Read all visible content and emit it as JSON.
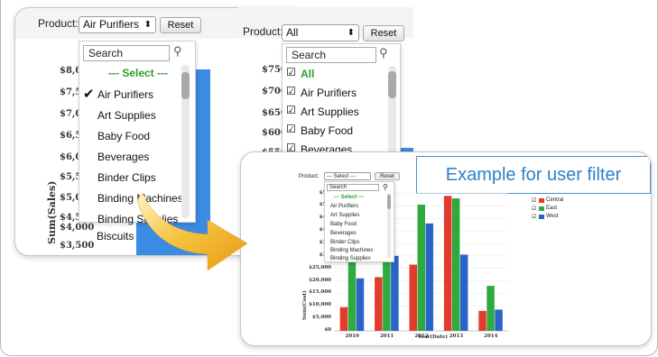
{
  "panel_left": {
    "product_label": "Product:",
    "product_value": "Air Purifiers",
    "reset_label": "Reset",
    "search_placeholder": "Search",
    "items": [
      "--- Select ---",
      "Air Purifiers",
      "Art Supplies",
      "Baby Food",
      "Beverages",
      "Binder Clips",
      "Binding Machines",
      "Binding Supplies",
      "Biscuits"
    ],
    "selected_item": "Air Purifiers",
    "y_ticks": [
      "$8,0",
      "$7,5",
      "$7,0",
      "$6,5",
      "$6,0",
      "$5,5",
      "$5,0",
      "$4,5",
      "$4,000",
      "$3,500"
    ],
    "y_axis_label": "Sum(Sales)",
    "bar_color": "#3b8ae3"
  },
  "panel_middle": {
    "product_label": "Product:",
    "product_value": "All",
    "reset_label": "Reset",
    "search_placeholder": "Search",
    "items": [
      "All",
      "Air Purifiers",
      "Art Supplies",
      "Baby Food",
      "Beverages"
    ],
    "y_ticks": [
      "$750",
      "$700",
      "$650",
      "$600",
      "$550"
    ]
  },
  "panel_right": {
    "callout_text": "Example for user filter",
    "product_label": "Product:",
    "product_value": "--- Select ---",
    "reset_label": "Reset",
    "search_placeholder": "Search",
    "items": [
      "--- Select ---",
      "Air Purifiers",
      "Art Supplies",
      "Baby Food",
      "Beverages",
      "Binder Clips",
      "Binding Machines",
      "Binding Supplies"
    ],
    "y_axis_label": "Sum(Cost)",
    "x_axis_label": "Year(Date)",
    "legend": [
      {
        "name": "Central",
        "color": "#e23b2e"
      },
      {
        "name": "East",
        "color": "#2eaa3e"
      },
      {
        "name": "West",
        "color": "#2a64c8"
      }
    ]
  },
  "chart_data": {
    "type": "bar",
    "categories": [
      "2010",
      "2011",
      "2012",
      "2013",
      "2014"
    ],
    "series": [
      {
        "name": "Central",
        "values": [
          9500,
          21500,
          26500,
          54000,
          8000
        ]
      },
      {
        "name": "East",
        "values": [
          39000,
          55000,
          50500,
          53000,
          18000
        ]
      },
      {
        "name": "West",
        "values": [
          21000,
          30000,
          43000,
          30500,
          8500
        ]
      }
    ],
    "y_ticks": [
      "$55,",
      "$50,",
      "$45,",
      "$40,",
      "$35,",
      "$30,",
      "$25,000",
      "$20,000",
      "$15,000",
      "$10,000",
      "$5,000",
      "$0"
    ],
    "ylabel": "Sum(Cost)",
    "xlabel": "Year(Date)",
    "ylim": [
      0,
      57000
    ],
    "legend": "top-right",
    "colors": [
      "#e23b2e",
      "#2eaa3e",
      "#2a64c8"
    ]
  }
}
